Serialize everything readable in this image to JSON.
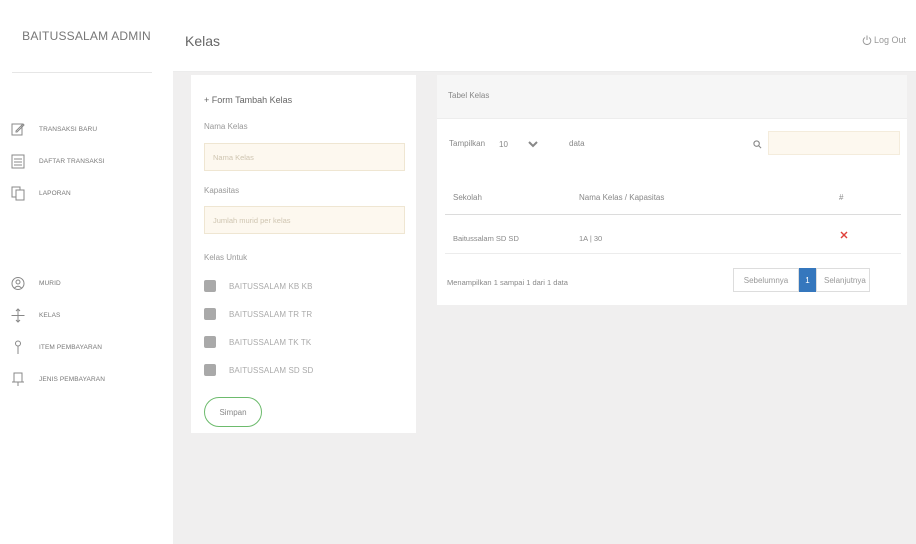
{
  "sidebar": {
    "brand": "BAITUSSALAM ADMIN",
    "items": [
      {
        "label": "TRANSAKSI BARU",
        "icon": "edit-icon"
      },
      {
        "label": "DAFTAR TRANSAKSI",
        "icon": "list-icon"
      },
      {
        "label": "LAPORAN",
        "icon": "copy-icon"
      },
      {
        "label": "MURID",
        "icon": "user-icon"
      },
      {
        "label": "KELAS",
        "icon": "move-icon"
      },
      {
        "label": "ITEM PEMBAYARAN",
        "icon": "pin-icon"
      },
      {
        "label": "JENIS PEMBAYARAN",
        "icon": "bookmark-icon"
      }
    ]
  },
  "header": {
    "title": "Kelas",
    "logout_label": "Log Out"
  },
  "form": {
    "title": "+ Form Tambah Kelas",
    "nama_label": "Nama Kelas",
    "nama_placeholder": "Nama Kelas",
    "kapasitas_label": "Kapasitas",
    "kapasitas_placeholder": "Jumlah murid per kelas",
    "kelas_untuk_label": "Kelas Untuk",
    "options": [
      "BAITUSSALAM KB KB",
      "BAITUSSALAM TR TR",
      "BAITUSSALAM TK TK",
      "BAITUSSALAM SD SD"
    ],
    "save_label": "Simpan"
  },
  "table": {
    "card_title": "Tabel Kelas",
    "show_label": "Tampilkan",
    "entries_value": "10",
    "data_label": "data",
    "columns": [
      "Sekolah",
      "Nama Kelas / Kapasitas",
      "#"
    ],
    "rows": [
      {
        "sekolah": "Baitussalam SD SD",
        "nama_kapasitas": "1A | 30"
      }
    ],
    "info": "Menampilkan 1 sampai 1 dari 1 data",
    "pagination": {
      "prev": "Sebelumnya",
      "current": "1",
      "next": "Selanjutnya"
    }
  },
  "colors": {
    "accent": "#3577bd",
    "save_border": "#6dbb6d",
    "delete": "#e0403a",
    "input_bg": "#fdf8ef"
  }
}
